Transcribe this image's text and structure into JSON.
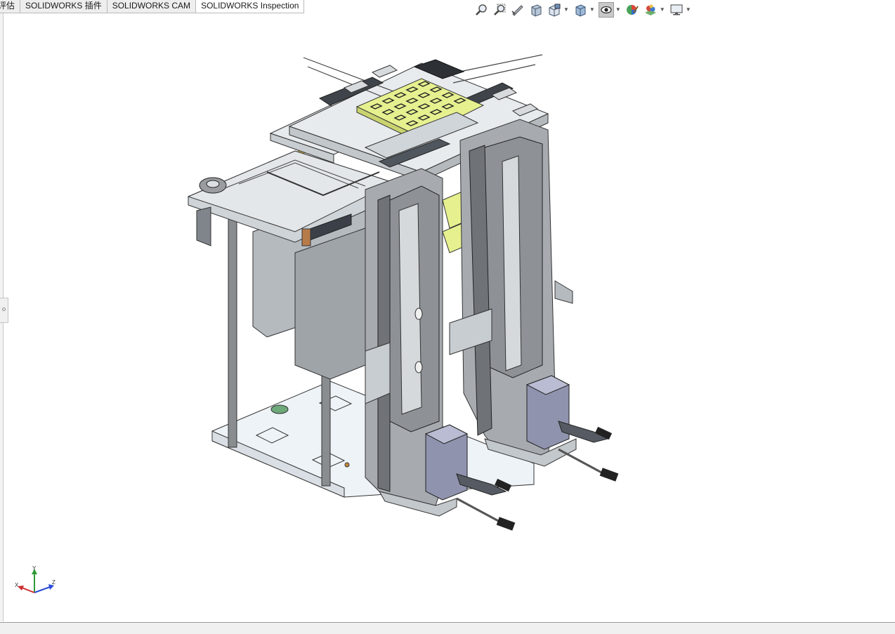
{
  "command_manager": {
    "tabs": [
      {
        "label": "评估",
        "active": false
      },
      {
        "label": "SOLIDWORKS 插件",
        "active": false
      },
      {
        "label": "SOLIDWORKS CAM",
        "active": false
      },
      {
        "label": "SOLIDWORKS Inspection",
        "active": true
      }
    ]
  },
  "heads_up_toolbar": {
    "icons": [
      "zoom-to-fit-icon",
      "zoom-to-area-icon",
      "previous-view-icon",
      "section-view-icon",
      "view-orientation-icon",
      "display-style-icon",
      "hide-show-items-icon",
      "edit-appearance-icon",
      "apply-scene-icon",
      "view-settings-icon"
    ]
  },
  "triad": {
    "x_label": "X",
    "y_label": "Y",
    "z_label": "Z"
  },
  "colors": {
    "accent_yellow": "#e6f08f",
    "frame_gray": "#8e9297",
    "motor_blue": "#8f93ad",
    "background": "#ffffff"
  }
}
